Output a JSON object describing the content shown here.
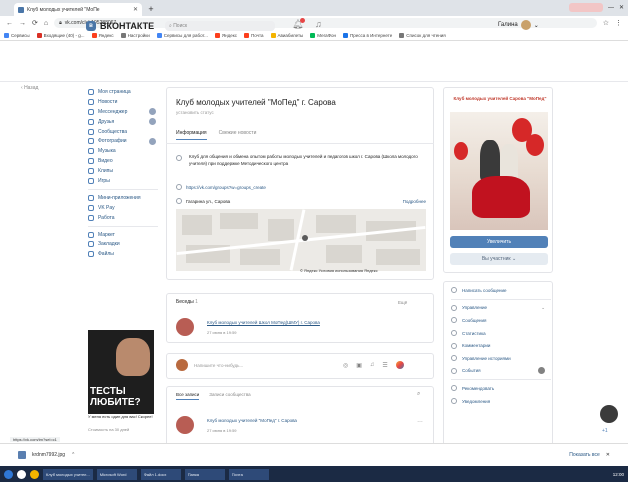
{
  "browser": {
    "tab_title": "Клуб молодых учителей \"МоПе",
    "url": "vk.com/club195288067",
    "bookmarks": [
      "Сервисы",
      "Входящие (40) - g...",
      "Яндекс",
      "Настройки",
      "Сервисы для работ...",
      "Яндекс",
      "Почта",
      "Авиабилеты",
      "МегаФон",
      "Пресса в Интернете",
      "Список для чтения"
    ]
  },
  "vk": {
    "logo_text": "ВКОНТАКТЕ",
    "search_placeholder": "Поиск",
    "user_name": "Галина"
  },
  "back_label": "Назад",
  "nav": {
    "group1": [
      "Моя страница",
      "Новости",
      "Мессенджер",
      "Друзья",
      "Сообщества",
      "Фотографии",
      "Музыка",
      "Видео",
      "Клипы",
      "Игры"
    ],
    "group2": [
      "Мини-приложения",
      "VK Pay",
      "Работа"
    ],
    "group3": [
      "Маркет",
      "Закладки",
      "Файлы"
    ]
  },
  "promo": {
    "big_text": "ТЕСТЫ ЛЮБИТЕ?",
    "caption": "У меня есть один для вас! Скорее!",
    "sub": "Стоимость на 30 дней"
  },
  "group": {
    "title": "Клуб молодых учителей \"МоПед\" г. Сарова",
    "status": "установить статус",
    "tab_info": "Информация",
    "tab_news": "Свежие новости",
    "description": "Клуб для общения и обмена опытом работы молодых учителей и педагогов школ г. Сарова (Школа молодого учителя) при поддержке Методического центра",
    "website": "https://vk.com/groups?w=groups_create",
    "address": "Гагарина ул., Сарова",
    "address_more": "Подробнее",
    "map_footer": "© Яндекс Условия использования Яндекс"
  },
  "events": {
    "label": "Беседы",
    "count": "1",
    "all": "Ещё",
    "item_name": "Клуб молодых учителей Школ МоПед(ШМУ) г. Сарова",
    "item_date": "27 июня в 19:59"
  },
  "compose": {
    "placeholder": "Напишите что-нибудь..."
  },
  "posts": {
    "tab_all": "Все записи",
    "tab_community": "Записи сообщества",
    "item_name": "Клуб молодых учителей \"МоПед\" г. Сарова",
    "item_date": "27 июня в 19:59"
  },
  "cover": {
    "title": "Клуб молодых учителей Сарова \"МоПед\""
  },
  "buttons": {
    "join": "Увеличить",
    "participant": "Вы участник"
  },
  "actions": [
    "Написать сообщение",
    "Управление",
    "Сообщения",
    "Статистика",
    "Комментарии",
    "Управление историями",
    "События",
    "Рекомендовать",
    "Уведомления"
  ],
  "status_url": "https://vk.com/im?sel=c1",
  "download": {
    "file": "krdnm7992.jpg",
    "show_all": "Показать все"
  },
  "taskbar": {
    "tasks": [
      "Клуб молодых учител...",
      "Microsoft Word",
      "Файл 1.docx",
      "Папка",
      "Почта"
    ],
    "clock": "12:00"
  },
  "colors": {
    "vk_blue": "#4a76a8",
    "button_blue": "#5181b8",
    "link": "#2a5885"
  }
}
